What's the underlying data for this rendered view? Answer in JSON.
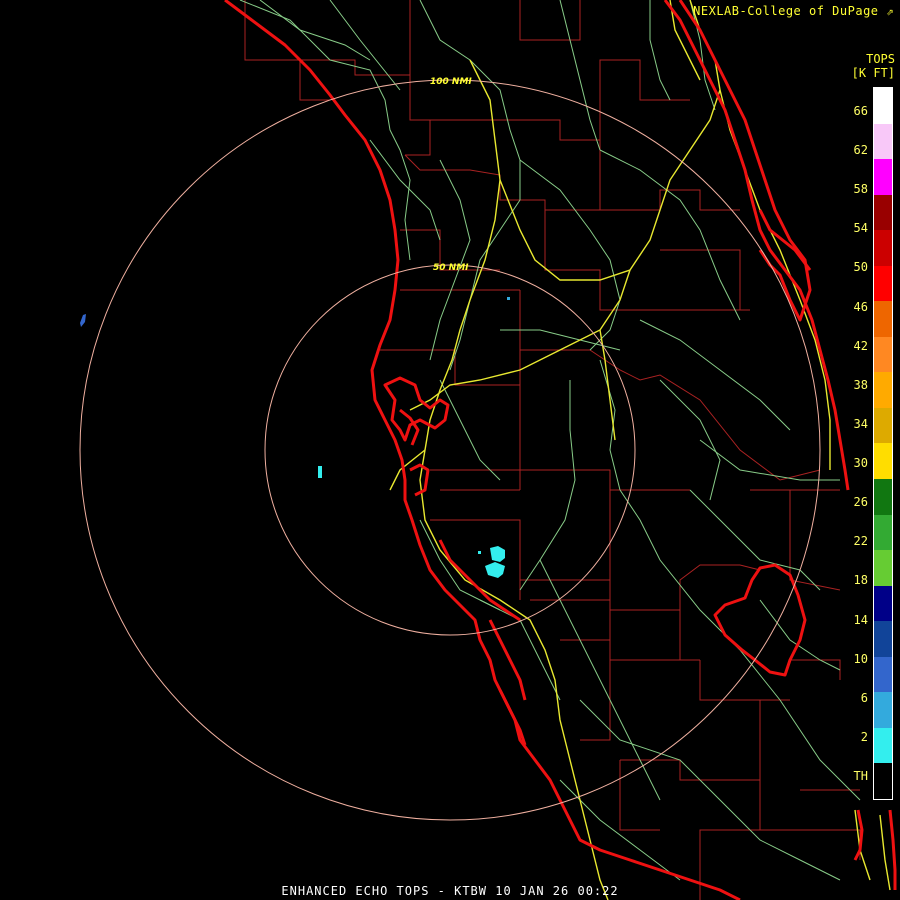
{
  "credit": "NEXLAB-College of DuPage",
  "credit_icon": "arrow-icon",
  "legend": {
    "title_line1": "TOPS",
    "title_line2": "[K FT]",
    "labels": [
      "66",
      "62",
      "58",
      "54",
      "50",
      "46",
      "42",
      "38",
      "34",
      "30",
      "26",
      "22",
      "18",
      "14",
      "10",
      "6",
      "2",
      "TH"
    ],
    "colors": [
      "#ffffff",
      "#f8c8f8",
      "#ff00ff",
      "#990000",
      "#cc0000",
      "#ff0000",
      "#ee6600",
      "#ff8822",
      "#ffaa00",
      "#ddaa00",
      "#ffdd00",
      "#117711",
      "#33aa33",
      "#66cc33",
      "#000088",
      "#114499",
      "#3366cc",
      "#33aadd",
      "#33eeee",
      "#000000"
    ]
  },
  "rings": {
    "outer_label": "100 NMI",
    "inner_label": "50 NMI"
  },
  "colors": {
    "coast": "#ee1111",
    "county": "#aa2222",
    "highway": "#e8e830",
    "road": "#88cc88",
    "ring": "#f0b0a0",
    "echo": "#33eeee",
    "echo_dark": "#3366cc"
  },
  "footer": "ENHANCED ECHO TOPS - KTBW 10 JAN 26 00:22"
}
